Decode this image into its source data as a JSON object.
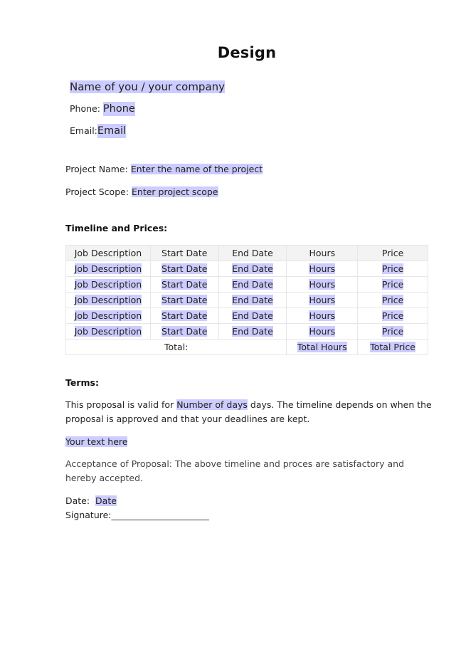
{
  "document": {
    "title": "Design",
    "company": {
      "name_placeholder": "Name of you / your company",
      "phone_label": "Phone: ",
      "phone_value": "Phone",
      "email_label": "Email:",
      "email_value": "Email"
    },
    "project": {
      "name_label": "Project Name: ",
      "name_value": "Enter the name of the project",
      "scope_label": "Project Scope: ",
      "scope_value": "Enter project scope"
    },
    "timeline": {
      "heading": "Timeline and Prices:",
      "columns": [
        "Job Description",
        "Start Date",
        "End Date",
        "Hours",
        "Price"
      ],
      "rows": [
        [
          "Job Description",
          "Start Date",
          "End Date",
          "Hours",
          "Price"
        ],
        [
          "Job Description",
          "Start Date",
          "End Date",
          "Hours",
          "Price"
        ],
        [
          "Job Description",
          "Start Date",
          "End Date",
          "Hours",
          "Price"
        ],
        [
          "Job Description",
          "Start Date",
          "End Date",
          "Hours",
          "Price"
        ],
        [
          "Job Description",
          "Start Date",
          "End Date",
          "Hours",
          "Price"
        ]
      ],
      "total_label": "Total:",
      "total_hours": "Total Hours",
      "total_price": "Total Price"
    },
    "terms": {
      "heading": "Terms:",
      "validity_prefix": "This proposal is valid for ",
      "validity_days": "Number of days",
      "validity_suffix": " days. The timeline depends on when the proposal is approved and that your deadlines are kept.",
      "custom_text": "Your text here",
      "acceptance": "Acceptance of Proposal: The above timeline and proces are satisfactory and hereby accepted.",
      "date_label": "Date:  ",
      "date_value": "Date",
      "signature_label": "Signature:",
      "signature_line": "______________________"
    },
    "highlight_color": "#ccccff"
  }
}
